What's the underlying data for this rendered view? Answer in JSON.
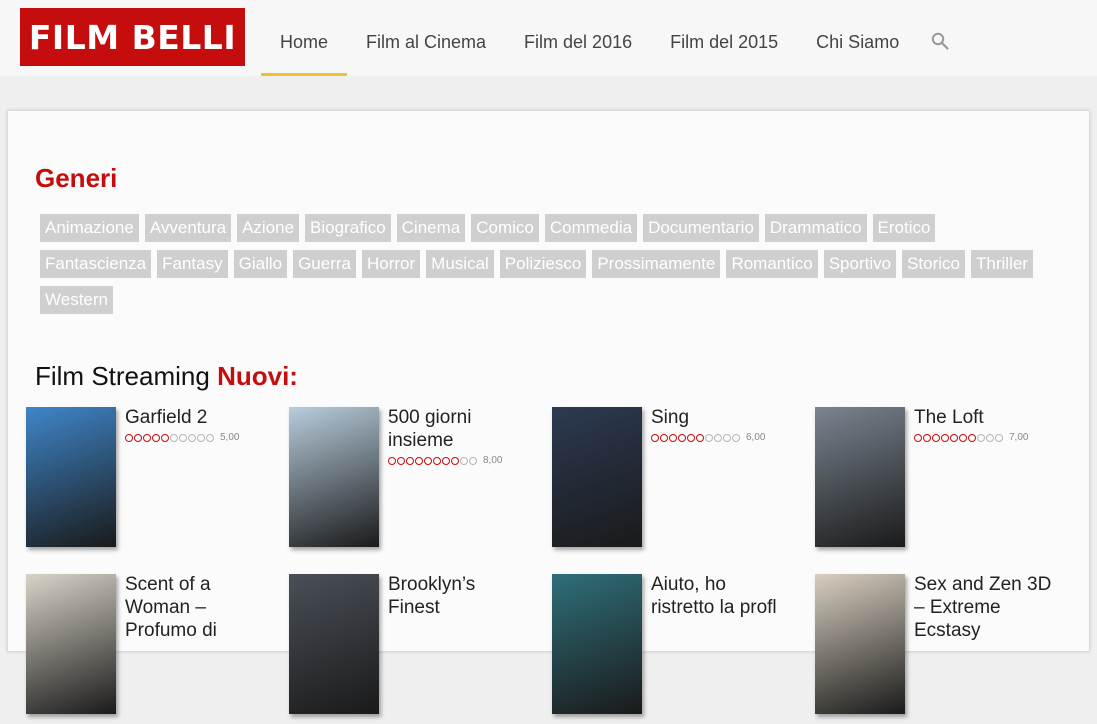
{
  "header": {
    "logo": "FILM BELLI",
    "nav": [
      "Home",
      "Film al Cinema",
      "Film del 2016",
      "Film del 2015",
      "Chi Siamo"
    ],
    "active_nav": "Home",
    "search_icon": "search-icon"
  },
  "genres": {
    "title": "Generi",
    "items": [
      "Animazione",
      "Avventura",
      "Azione",
      "Biografico",
      "Cinema",
      "Comico",
      "Commedia",
      "Documentario",
      "Drammatico",
      "Erotico",
      "Fantascienza",
      "Fantasy",
      "Giallo",
      "Guerra",
      "Horror",
      "Musical",
      "Poliziesco",
      "Prossimamente",
      "Romantico",
      "Sportivo",
      "Storico",
      "Thriller",
      "Western"
    ]
  },
  "streaming": {
    "title_prefix": "Film Streaming",
    "title_accent": "Nuovi:",
    "films": [
      {
        "title": "Garfield 2",
        "rating": 5,
        "score": "5,00",
        "poster_color": "#3f86c9"
      },
      {
        "title": "500 giorni insieme",
        "rating": 8,
        "score": "8,00",
        "poster_color": "#b8cddd"
      },
      {
        "title": "Sing",
        "rating": 6,
        "score": "6,00",
        "poster_color": "#2c3a52"
      },
      {
        "title": "The Loft",
        "rating": 7,
        "score": "7,00",
        "poster_color": "#7a8590"
      },
      {
        "title": "Scent of a Woman – Profumo di",
        "rating": null,
        "score": "",
        "poster_color": "#d9d4c8"
      },
      {
        "title": "Brooklyn’s Finest",
        "rating": null,
        "score": "",
        "poster_color": "#4a5058"
      },
      {
        "title": "Aiuto, ho ristretto la profl",
        "rating": null,
        "score": "",
        "poster_color": "#2f6f7a"
      },
      {
        "title": "Sex and Zen 3D – Extreme Ecstasy",
        "rating": null,
        "score": "",
        "poster_color": "#d8cfc0"
      }
    ]
  }
}
